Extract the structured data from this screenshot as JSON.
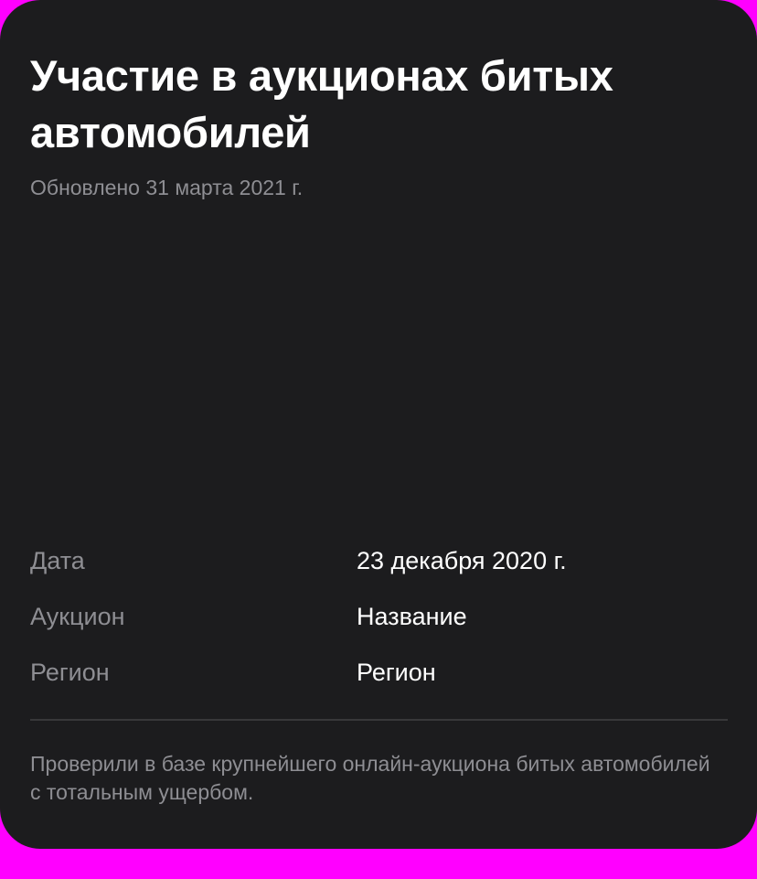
{
  "card": {
    "title": "Участие в аукционах битых автомобилей",
    "updated": "Обновлено 31 марта 2021 г.",
    "details": [
      {
        "label": "Дата",
        "value": "23 декабря 2020 г."
      },
      {
        "label": "Аукцион",
        "value": "Название"
      },
      {
        "label": "Регион",
        "value": "Регион"
      }
    ],
    "footnote": "Проверили в базе крупнейшего онлайн-аукциона битых автомобилей с тотальным ущербом."
  },
  "colors": {
    "background": "#ff00ff",
    "card": "#1c1c1e",
    "primary_text": "#ffffff",
    "secondary_text": "#8e8e93",
    "divider": "#38383a"
  }
}
